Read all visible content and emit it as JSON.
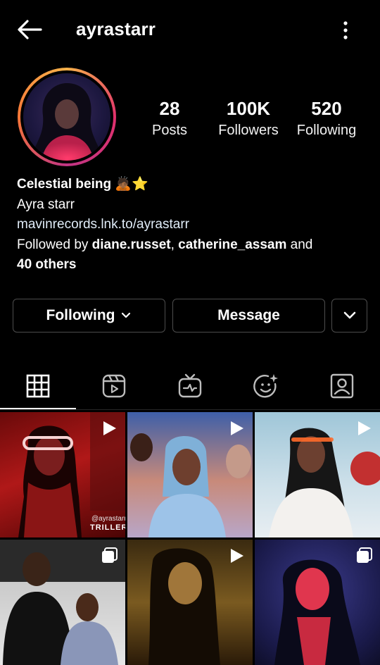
{
  "header": {
    "username": "ayrastarr",
    "back_icon": "arrow-left-icon",
    "more_icon": "more-vertical-icon"
  },
  "profile": {
    "posts_count": "28",
    "posts_label": "Posts",
    "followers_count": "100K",
    "followers_label": "Followers",
    "following_count": "520",
    "following_label": "Following"
  },
  "bio": {
    "headline": "Celestial being 🙇🏾⭐",
    "name": "Ayra starr",
    "link": "mavinrecords.lnk.to/ayrastarr",
    "followed_by_prefix": "Followed by ",
    "follower_1": "diane.russet",
    "separator": ", ",
    "follower_2": "catherine_assam",
    "and_text": " and",
    "others": "40 others"
  },
  "actions": {
    "following_label": "Following",
    "message_label": "Message"
  },
  "tabs": [
    {
      "icon": "grid-icon",
      "active": true
    },
    {
      "icon": "reels-icon",
      "active": false
    },
    {
      "icon": "igtv-icon",
      "active": false
    },
    {
      "icon": "effects-icon",
      "active": false
    },
    {
      "icon": "tagged-icon",
      "active": false
    }
  ],
  "posts": [
    {
      "type": "video",
      "overlay_text": "TRILLER",
      "watermark": "@ayrastarr"
    },
    {
      "type": "video"
    },
    {
      "type": "video"
    },
    {
      "type": "carousel"
    },
    {
      "type": "video"
    },
    {
      "type": "carousel"
    }
  ],
  "colors": {
    "background": "#000000",
    "border": "#4d4d4d",
    "ring_start": "#f7b24a",
    "ring_end": "#e1306c"
  }
}
